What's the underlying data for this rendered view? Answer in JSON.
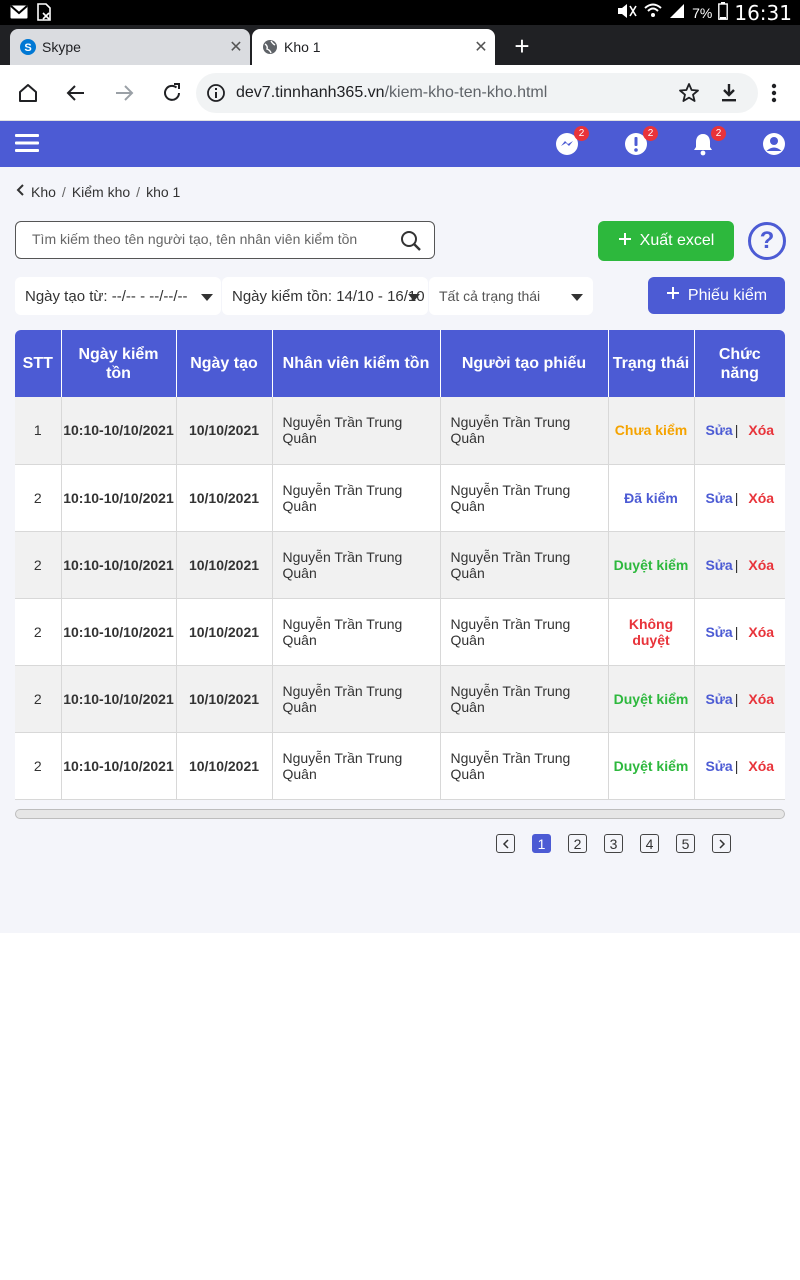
{
  "statusbar": {
    "battery": "7%",
    "time": "16:31"
  },
  "tabs": [
    {
      "title": "Skype",
      "icon": "skype-icon"
    },
    {
      "title": "Kho 1",
      "icon": "globe-icon"
    }
  ],
  "address": {
    "domain": "dev7.tinnhanh365.vn",
    "path": "/kiem-kho-ten-kho.html"
  },
  "header": {
    "badges": {
      "messenger": "2",
      "alert": "2",
      "bell": "2"
    }
  },
  "breadcrumb": {
    "items": [
      "Kho",
      "Kiểm kho",
      "kho 1"
    ]
  },
  "search": {
    "placeholder": "Tìm kiếm theo tên người tạo, tên nhân viên kiểm tồn"
  },
  "actions": {
    "excel_label": "Xuất excel",
    "help_label": "?",
    "add_label": "Phiếu kiểm"
  },
  "filters": {
    "created_label": "Ngày tạo từ:  --/-- - --/--/--",
    "checked_label": "Ngày kiểm tồn: 14/10 - 16/10",
    "status_label": "Tất cả trạng thái"
  },
  "table": {
    "columns": [
      "STT",
      "Ngày kiểm tồn",
      "Ngày tạo",
      "Nhân viên kiểm tồn",
      "Người tạo phiếu",
      "Trạng thái",
      "Chức năng"
    ],
    "edit_label": "Sửa",
    "delete_label": "Xóa",
    "rows": [
      {
        "stt": "1",
        "check_date": "10:10-10/10/2021",
        "created": "10/10/2021",
        "staff": "Nguyễn Trần Trung Quân",
        "creator": "Nguyễn Trần Trung Quân",
        "status": "Chưa kiểm",
        "status_color": "#f5a300"
      },
      {
        "stt": "2",
        "check_date": "10:10-10/10/2021",
        "created": "10/10/2021",
        "staff": "Nguyễn Trần Trung Quân",
        "creator": "Nguyễn Trần Trung Quân",
        "status": "Đã kiểm",
        "status_color": "#4c5bd4"
      },
      {
        "stt": "2",
        "check_date": "10:10-10/10/2021",
        "created": "10/10/2021",
        "staff": "Nguyễn Trần Trung Quân",
        "creator": "Nguyễn Trần Trung Quân",
        "status": "Duyệt kiểm",
        "status_color": "#2db83d"
      },
      {
        "stt": "2",
        "check_date": "10:10-10/10/2021",
        "created": "10/10/2021",
        "staff": "Nguyễn Trần Trung Quân",
        "creator": "Nguyễn Trần Trung Quân",
        "status": "Không duyệt",
        "status_color": "#e8333a"
      },
      {
        "stt": "2",
        "check_date": "10:10-10/10/2021",
        "created": "10/10/2021",
        "staff": "Nguyễn Trần Trung Quân",
        "creator": "Nguyễn Trần Trung Quân",
        "status": "Duyệt kiểm",
        "status_color": "#2db83d"
      },
      {
        "stt": "2",
        "check_date": "10:10-10/10/2021",
        "created": "10/10/2021",
        "staff": "Nguyễn Trần Trung Quân",
        "creator": "Nguyễn Trần Trung Quân",
        "status": "Duyệt kiểm",
        "status_color": "#2db83d"
      }
    ]
  },
  "pagination": {
    "pages": [
      "1",
      "2",
      "3",
      "4",
      "5"
    ],
    "current": "1"
  },
  "colors": {
    "primary": "#4c5bd4",
    "success": "#2db83d",
    "danger": "#e8333a",
    "warning": "#f5a300"
  }
}
